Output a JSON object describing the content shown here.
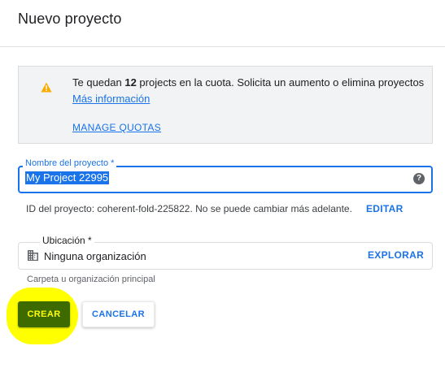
{
  "dialog": {
    "title": "Nuevo proyecto"
  },
  "quota_notice": {
    "icon": "warning-icon",
    "icon_color": "#f9ab00",
    "text_prefix": "Te quedan ",
    "count": "12",
    "text_suffix": " projects en la cuota. Solicita un aumento o elimina proyectos",
    "more_info_link": "Más información",
    "manage_link": "MANAGE QUOTAS"
  },
  "project_name": {
    "label": "Nombre del proyecto *",
    "value": "My Project 22995",
    "help_icon": "help-icon"
  },
  "project_id": {
    "text": "ID del proyecto: coherent-fold-225822. No se puede cambiar más adelante.",
    "edit_label": "EDITAR"
  },
  "location": {
    "label": "Ubicación *",
    "icon": "building-icon",
    "value": "Ninguna organización",
    "explore_label": "EXPLORAR",
    "helper": "Carpeta u organización principal"
  },
  "actions": {
    "create_label": "CREAR",
    "cancel_label": "CANCELAR"
  },
  "colors": {
    "accent": "#1a73e8",
    "create_button": "#3d6b00",
    "highlight": "#ffff00"
  }
}
